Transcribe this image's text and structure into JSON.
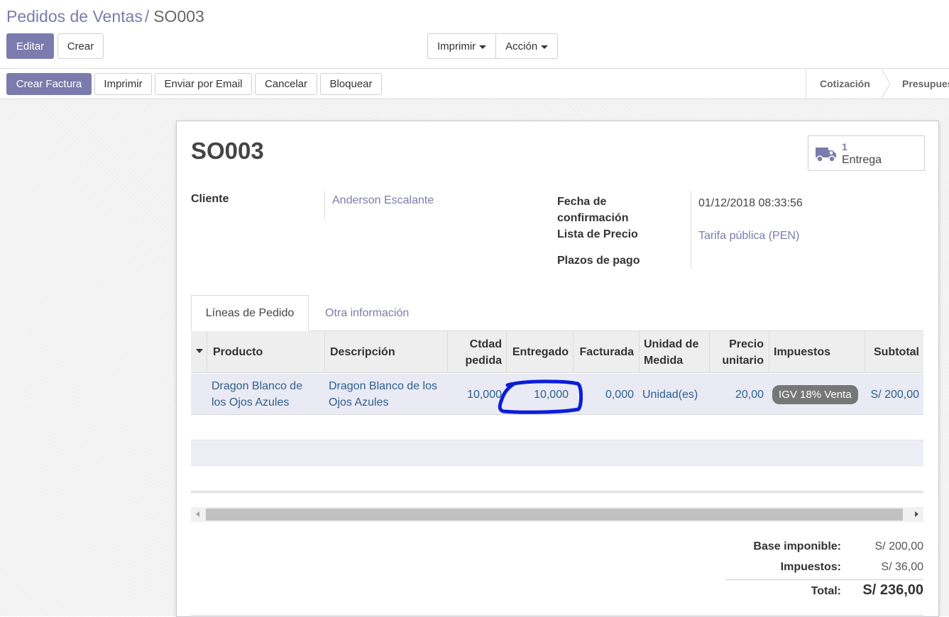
{
  "breadcrumb": {
    "parent": "Pedidos de Ventas",
    "separator": "/",
    "current": "SO003"
  },
  "buttons": {
    "edit": "Editar",
    "create": "Crear"
  },
  "actions": {
    "print": "Imprimir",
    "action": "Acción"
  },
  "statusbar": {
    "create_invoice": "Crear Factura",
    "print": "Imprimir",
    "send_email": "Enviar por Email",
    "cancel": "Cancelar",
    "lock": "Bloquear",
    "stages": [
      "Cotización",
      "Presupuest"
    ]
  },
  "order": {
    "name": "SO003",
    "delivery_count": "1",
    "delivery_label": "Entrega",
    "customer_label": "Cliente",
    "customer": "Anderson Escalante",
    "confirm_date_label_1": "Fecha de",
    "confirm_date_label_2": "confirmación",
    "confirm_date": "01/12/2018 08:33:56",
    "pricelist_label": "Lista de Precio",
    "pricelist": "Tarifa pública (PEN)",
    "payment_terms_label": "Plazos de pago"
  },
  "tabs": {
    "lines": "Líneas de Pedido",
    "other": "Otra información"
  },
  "table": {
    "headers": {
      "product": "Producto",
      "description": "Descripción",
      "qty_1": "Ctdad",
      "qty_2": "pedida",
      "delivered": "Entregado",
      "invoiced": "Facturada",
      "uom_1": "Unidad de",
      "uom_2": "Medida",
      "price_1": "Precio",
      "price_2": "unitario",
      "taxes": "Impuestos",
      "subtotal": "Subtotal"
    },
    "rows": [
      {
        "product_1": "Dragon Blanco de",
        "product_2": "los Ojos Azules",
        "description_1": "Dragon Blanco de los",
        "description_2": "Ojos Azules",
        "qty": "10,000",
        "delivered": "10,000",
        "invoiced": "0,000",
        "uom": "Unidad(es)",
        "price": "20,00",
        "tax": "IGV 18% Venta",
        "subtotal": "S/ 200,00"
      }
    ]
  },
  "totals": {
    "base_label": "Base imponible:",
    "base": "S/ 200,00",
    "tax_label": "Impuestos:",
    "tax": "S/ 36,00",
    "total_label": "Total:",
    "total": "S/ 236,00"
  },
  "colors": {
    "brand": "#7c7bad",
    "link": "#2e5e8a",
    "annotation": "#0a1ed8"
  }
}
